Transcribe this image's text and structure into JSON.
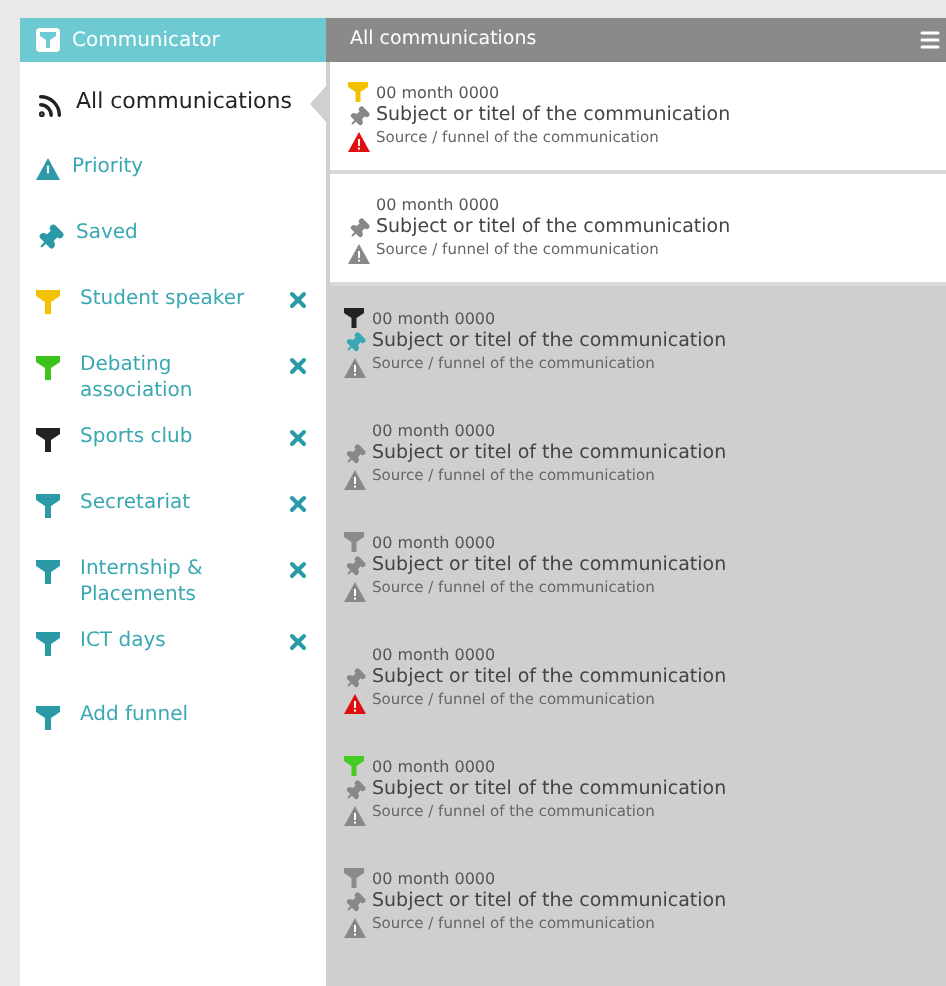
{
  "app": {
    "title": "Communicator"
  },
  "sidebar": {
    "items": [
      {
        "kind": "all",
        "label": "All communications",
        "selected": true
      },
      {
        "kind": "priority",
        "label": "Priority",
        "selected": false
      },
      {
        "kind": "saved",
        "label": "Saved",
        "selected": false
      },
      {
        "kind": "funnel",
        "label": "Student speaker",
        "color": "#f2c200",
        "selected": false
      },
      {
        "kind": "funnel",
        "label": "Debating association",
        "color": "#3dc41c",
        "selected": false
      },
      {
        "kind": "funnel",
        "label": "Sports club",
        "color": "#222222",
        "selected": false
      },
      {
        "kind": "funnel",
        "label": "Secretariat",
        "color": "#2a9aa6",
        "selected": false
      },
      {
        "kind": "funnel",
        "label": "Internship & Placements",
        "color": "#2a9aa6",
        "selected": false
      },
      {
        "kind": "funnel",
        "label": "ICT days",
        "color": "#2a9aa6",
        "selected": false
      },
      {
        "kind": "add",
        "label": "Add funnel",
        "selected": false
      }
    ]
  },
  "list": {
    "title": "All communications",
    "messages": [
      {
        "date": "00 month 0000",
        "subject": "Subject or titel of the communication",
        "source": "Source / funnel of the communication",
        "color": "#f2c200",
        "pinned": false,
        "priority": true,
        "unread": true
      },
      {
        "date": "00 month 0000",
        "subject": "Subject or titel of the communication",
        "source": "Source / funnel of the communication",
        "pinned": false,
        "priority": false,
        "unread": true
      },
      {
        "date": "00 month 0000",
        "subject": "Subject or titel of the communication",
        "source": "Source / funnel of the communication",
        "color": "#222222",
        "pinned": true,
        "priority": false,
        "unread": false
      },
      {
        "date": "00 month 0000",
        "subject": "Subject or titel of the communication",
        "source": "Source / funnel of the communication",
        "pinned": false,
        "priority": false,
        "unread": false
      },
      {
        "date": "00 month 0000",
        "subject": "Subject or titel of the communication",
        "source": "Source / funnel of the communication",
        "color": "#8a8a8a",
        "pinned": false,
        "priority": false,
        "unread": false
      },
      {
        "date": "00 month 0000",
        "subject": "Subject or titel of the communication",
        "source": "Source / funnel of the communication",
        "pinned": false,
        "priority": true,
        "unread": false
      },
      {
        "date": "00 month 0000",
        "subject": "Subject or titel of the communication",
        "source": "Source / funnel of the communication",
        "color": "#44cc22",
        "pinned": false,
        "priority": false,
        "unread": false
      },
      {
        "date": "00 month 0000",
        "subject": "Subject or titel of the communication",
        "source": "Source / funnel of the communication",
        "color": "#8a8a8a",
        "pinned": false,
        "priority": false,
        "unread": false
      }
    ]
  }
}
